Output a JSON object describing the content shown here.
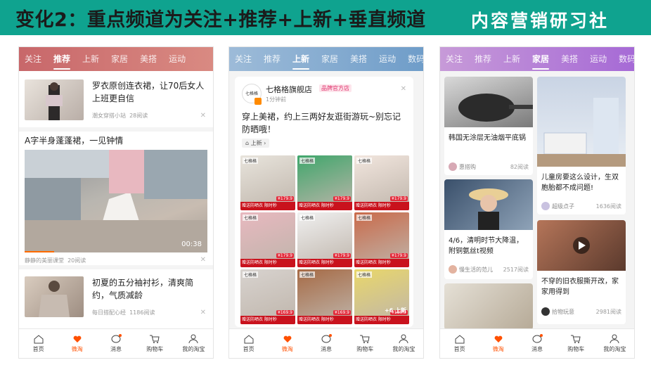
{
  "banner": {
    "title": "变化2：重点频道为关注+推荐+上新+垂直频道",
    "brand": "内容营销研习社"
  },
  "tabs_common": [
    "关注",
    "推荐",
    "上新",
    "家居",
    "美搭",
    "运动",
    "数码"
  ],
  "colors": {
    "accent": "#ff5000",
    "banner_bg": "#0fa38f",
    "p1_header": "#c8676a",
    "p2_header": "#7ea9d1",
    "p3_header": "#b079d6"
  },
  "nav": {
    "items": [
      {
        "label": "首页",
        "icon": "home-icon"
      },
      {
        "label": "微淘",
        "icon": "heart-wave-icon"
      },
      {
        "label": "消息",
        "icon": "message-icon"
      },
      {
        "label": "购物车",
        "icon": "cart-icon"
      },
      {
        "label": "我的淘宝",
        "icon": "user-icon"
      }
    ]
  },
  "phone1": {
    "active_tab": "推荐",
    "item1": {
      "title": "罗衣原创连衣裙，让70后女人上班更自信",
      "source": "潮女穿搭小站",
      "reads": "28阅读"
    },
    "video": {
      "title": "A字半身蓬蓬裙，一见钟情",
      "duration": "00:38",
      "source": "静静的美丽课堂",
      "reads": "20阅读",
      "progress": 0.16
    },
    "item2": {
      "title": "初夏的五分袖衬衫，清爽简约，气质减龄",
      "source": "每日搭配心经",
      "reads": "1186阅读"
    }
  },
  "phone2": {
    "active_tab": "上新",
    "shop": {
      "name": "七格格旗舰店",
      "badge": "品牌官方店",
      "time": "1分钟前",
      "logo": "七格格"
    },
    "post": "穿上美裙，约上三两好友逛街游玩~别忘记防晒哦！",
    "tag": "上新",
    "grid_tag": "赠送防晒衣 限时秒",
    "prices": [
      "¥179.9",
      "¥179.9",
      "¥179.9",
      "¥179.9",
      "¥179.9",
      "¥179.9",
      "¥169.9",
      "¥169.9",
      "¥189.9"
    ],
    "more": "+6 上新"
  },
  "phone3": {
    "active_tab": "家居",
    "cards": [
      {
        "title": "韩国无涂层无油烟平底锅",
        "author": "惠搭购",
        "reads": "82阅读"
      },
      {
        "title": "儿童房要这么设计，生双胞胎都不成问题!",
        "author": "超级点子",
        "reads": "1636阅读"
      },
      {
        "title": "4/6，清明时节大降温，附铜氨丝t视频",
        "author": "慢生活的范儿",
        "reads": "2517阅读"
      },
      {
        "title": "不穿的旧衣服撕开改，家家用得到",
        "author": "拾物玩意",
        "reads": "2981阅读"
      }
    ]
  }
}
